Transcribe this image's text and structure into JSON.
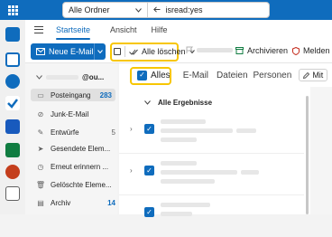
{
  "topbar": {
    "folder_selector": "Alle Ordner",
    "search_query": "isread:yes"
  },
  "menu": {
    "tabs": [
      {
        "label": "Startseite",
        "active": true
      },
      {
        "label": "Ansicht",
        "active": false
      },
      {
        "label": "Hilfe",
        "active": false
      }
    ]
  },
  "ribbon": {
    "new_mail": "Neue E-Mail",
    "select_all": "Alle löschen",
    "archive": "Archivieren",
    "report": "Melden"
  },
  "nav": {
    "account": "@ou...",
    "folders": [
      {
        "label": "Posteingang",
        "count": "283",
        "icon": "inbox-icon"
      },
      {
        "label": "Junk-E-Mail",
        "count": "",
        "icon": "junk-icon"
      },
      {
        "label": "Entwürfe",
        "count": "5",
        "icon": "drafts-icon"
      },
      {
        "label": "Gesendete Elem...",
        "count": "",
        "icon": "send-icon"
      },
      {
        "label": "Erneut erinnern ...",
        "count": "",
        "icon": "clock-icon"
      },
      {
        "label": "Gelöschte Eleme...",
        "count": "",
        "icon": "trash-icon"
      },
      {
        "label": "Archiv",
        "count": "14",
        "icon": "archive-icon"
      }
    ]
  },
  "list": {
    "filters": {
      "all": "Alles",
      "email": "E-Mail",
      "files": "Dateien",
      "people": "Personen",
      "mit": "Mit"
    },
    "group": "Alle Ergebnisse"
  },
  "colors": {
    "accent": "#0f6cbd",
    "highlight": "#f7c600"
  }
}
